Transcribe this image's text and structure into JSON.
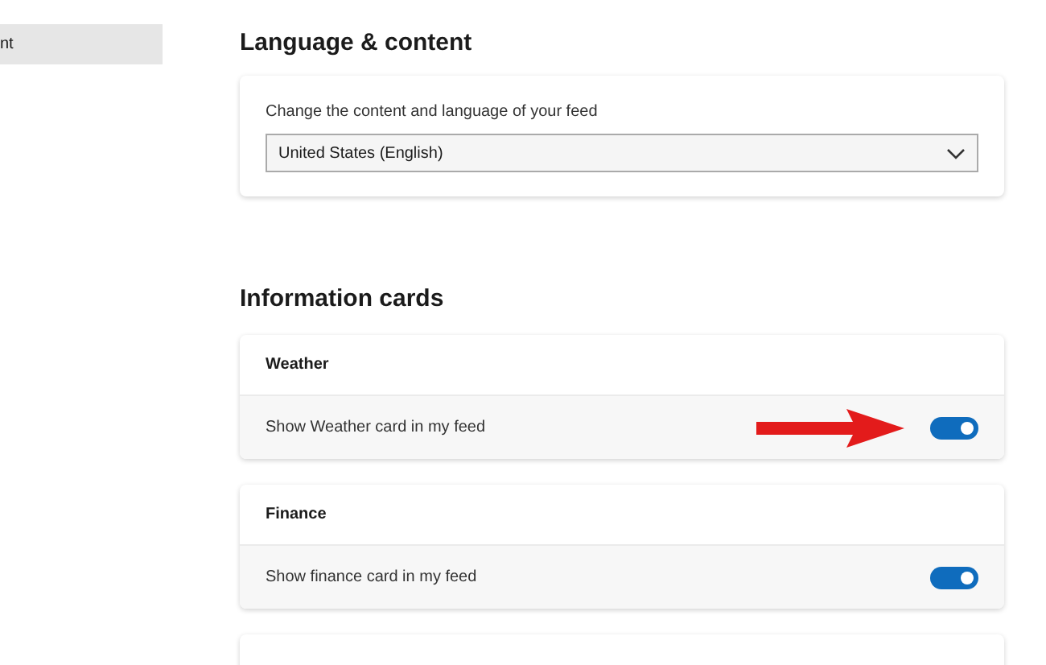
{
  "sidebar": {
    "items": [
      {
        "label": "nt",
        "selected": true
      }
    ]
  },
  "language_section": {
    "title": "Language & content",
    "label": "Change the content and language of your feed",
    "dropdown": {
      "value": "United States (English)"
    }
  },
  "cards_section": {
    "title": "Information cards",
    "cards": [
      {
        "title": "Weather",
        "setting": "Show Weather card in my feed",
        "on": true,
        "annotated": true
      },
      {
        "title": "Finance",
        "setting": "Show finance card in my feed",
        "on": true,
        "annotated": false
      }
    ]
  }
}
